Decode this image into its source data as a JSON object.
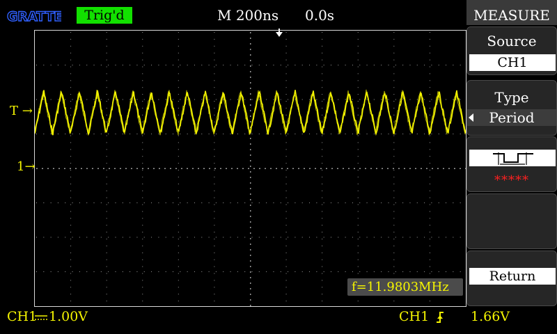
{
  "header": {
    "brand": "GRATTEN",
    "status": "Trig'd",
    "timebase": "M 200ns",
    "delay": "0.0s"
  },
  "markers": {
    "trigger_level": "T →",
    "ch1_ground": "1→"
  },
  "measurement": {
    "frequency": "f=11.9803MHz"
  },
  "footer": {
    "ch1_label": "CH1",
    "ch1_scale": "1.00V",
    "trigger_source": "CH1",
    "trigger_level": "1.66V"
  },
  "menu": {
    "title": "MEASURE",
    "source_label": "Source",
    "source_value": "CH1",
    "type_label": "Type",
    "type_value": "Period",
    "result": "*****",
    "return_label": "Return"
  },
  "waveform": {
    "channel": "CH1",
    "color": "#f5f500",
    "cycles_on_screen": 24
  },
  "colors": {
    "background": "#000000",
    "trace": "#f5f500",
    "status_ok": "#12e000",
    "result_error": "#ff2020"
  }
}
